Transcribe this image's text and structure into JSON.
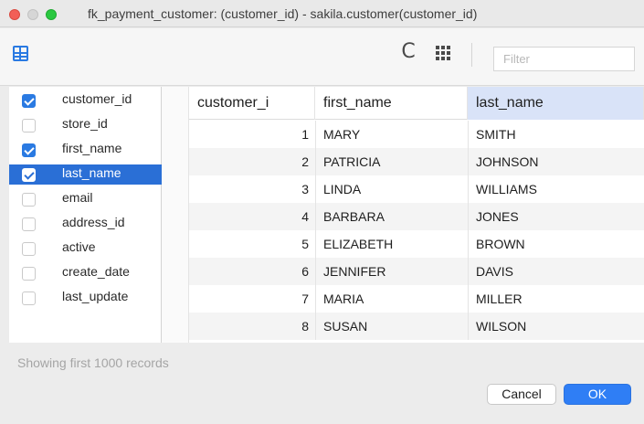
{
  "window": {
    "title": "fk_payment_customer: (customer_id) - sakila.customer(customer_id)"
  },
  "toolbar": {
    "grid_icon": "table-grid-icon",
    "refresh_icon": "refresh-icon",
    "columns_icon": "columns-grid-icon",
    "refresh_glyph": "C",
    "filter_placeholder": "Filter"
  },
  "columns": [
    {
      "label": "customer_id",
      "checked": true,
      "selected": false
    },
    {
      "label": "store_id",
      "checked": false,
      "selected": false
    },
    {
      "label": "first_name",
      "checked": true,
      "selected": false
    },
    {
      "label": "last_name",
      "checked": true,
      "selected": true
    },
    {
      "label": "email",
      "checked": false,
      "selected": false
    },
    {
      "label": "address_id",
      "checked": false,
      "selected": false
    },
    {
      "label": "active",
      "checked": false,
      "selected": false
    },
    {
      "label": "create_date",
      "checked": false,
      "selected": false
    },
    {
      "label": "last_update",
      "checked": false,
      "selected": false
    }
  ],
  "grid": {
    "headers": [
      "customer_i",
      "first_name",
      "last_name"
    ],
    "active_header": 2,
    "rows": [
      {
        "customer_id": "1",
        "first_name": "MARY",
        "last_name": "SMITH"
      },
      {
        "customer_id": "2",
        "first_name": "PATRICIA",
        "last_name": "JOHNSON"
      },
      {
        "customer_id": "3",
        "first_name": "LINDA",
        "last_name": "WILLIAMS"
      },
      {
        "customer_id": "4",
        "first_name": "BARBARA",
        "last_name": "JONES"
      },
      {
        "customer_id": "5",
        "first_name": "ELIZABETH",
        "last_name": "BROWN"
      },
      {
        "customer_id": "6",
        "first_name": "JENNIFER",
        "last_name": "DAVIS"
      },
      {
        "customer_id": "7",
        "first_name": "MARIA",
        "last_name": "MILLER"
      },
      {
        "customer_id": "8",
        "first_name": "SUSAN",
        "last_name": "WILSON"
      }
    ]
  },
  "footer": {
    "status": "Showing first 1000 records",
    "cancel_label": "Cancel",
    "ok_label": "OK"
  },
  "colors": {
    "accent": "#2a7ae2",
    "selection": "#2a6fd6",
    "active_header": "#d9e3f8",
    "ok_button": "#2f7ef5"
  }
}
